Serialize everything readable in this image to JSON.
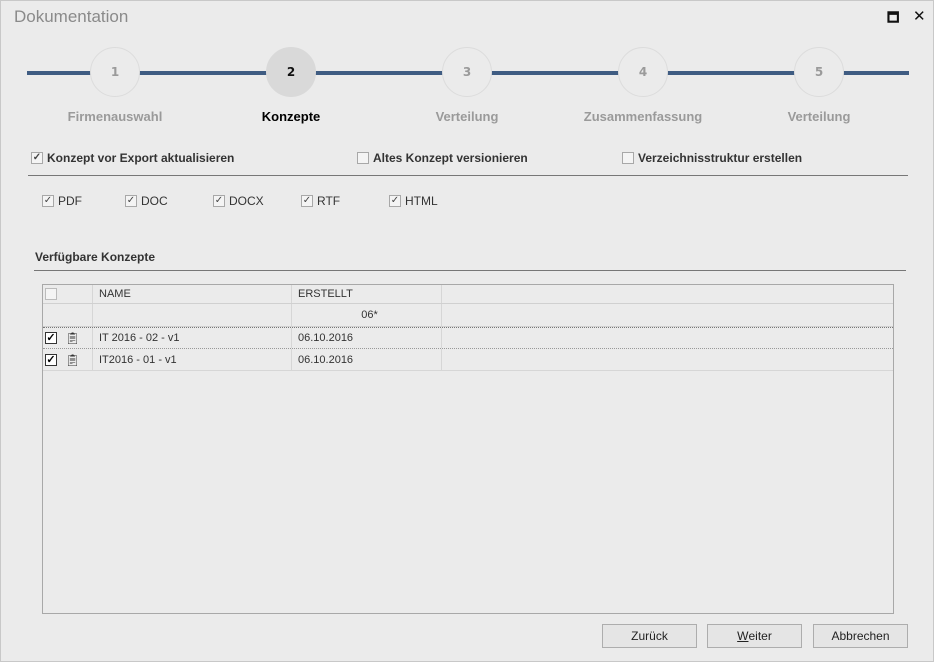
{
  "window": {
    "title": "Dokumentation",
    "maximize_icon": "maximize-icon",
    "close_icon": "close-icon"
  },
  "colors": {
    "stepper_line": "#3f5c82",
    "active_step_bg": "#d9d9d9"
  },
  "stepper": {
    "active": 2,
    "steps": [
      {
        "number": "1",
        "label": "Firmenauswahl"
      },
      {
        "number": "2",
        "label": "Konzepte"
      },
      {
        "number": "3",
        "label": "Verteilung"
      },
      {
        "number": "4",
        "label": "Zusammenfassung"
      },
      {
        "number": "5",
        "label": "Verteilung"
      }
    ]
  },
  "options": [
    {
      "label": "Konzept vor Export aktualisieren",
      "checked": true
    },
    {
      "label": "Altes Konzept versionieren",
      "checked": false
    },
    {
      "label": "Verzeichnisstruktur erstellen",
      "checked": false
    }
  ],
  "formats": [
    {
      "label": "PDF",
      "checked": true
    },
    {
      "label": "DOC",
      "checked": true
    },
    {
      "label": "DOCX",
      "checked": true
    },
    {
      "label": "RTF",
      "checked": true
    },
    {
      "label": "HTML",
      "checked": true
    }
  ],
  "section": {
    "title": "Verfügbare Konzepte"
  },
  "table": {
    "columns": [
      "NAME",
      "ERSTELLT"
    ],
    "filter": {
      "name": "",
      "erstellt": "06*"
    },
    "rows": [
      {
        "checked": true,
        "icon": "clipboard-icon",
        "name": "IT 2016 - 02 - v1",
        "erstellt": "06.10.2016"
      },
      {
        "checked": true,
        "icon": "clipboard-icon",
        "name": "IT2016 - 01 - v1",
        "erstellt": "06.10.2016"
      }
    ]
  },
  "buttons": {
    "back": "Zurück",
    "next_mnemonic": "W",
    "next_rest": "eiter",
    "cancel": "Abbrechen"
  }
}
